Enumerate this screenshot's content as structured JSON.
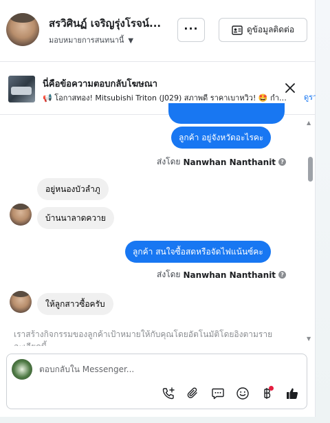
{
  "header": {
    "contact_name": "สรวิศินฏ์ เจริญรุ่งโรจน์...",
    "assign_label": "มอบหมายการสนทนานี้",
    "more_label": "···",
    "contact_info_label": "ดูข้อมูลติดต่อ"
  },
  "ad": {
    "title": "นี่คือข้อความตอบกลับโฆษณา",
    "description": "📢 โอกาสทอง! Mitsubishi Triton (J029) สภาพดี ราคาเบาหวิว! 🤩 กำลั...",
    "link_label": "ดูรา"
  },
  "messages": {
    "out1": "ลูกค้า   อยู่จังหวัดอะไรคะ",
    "sent_prefix": "ส่งโดย",
    "sender": "Nanwhan Nanthanit",
    "in1": "อยู่หนองบัวลำภู",
    "in2": "บ้านนาลาดควาย",
    "out2": "ลูกค้า  สนใจซื้อสดหรือจัดไฟแน้นซ์คะ",
    "in3": "ให้ลูกสาวซื้อครับ",
    "notice": "เราสร้างกิจกรรมของลูกค้าเป้าหมายให้กับคุณโดยอัตโนมัติโดยอิงตามรายละเอียดนี้"
  },
  "composer": {
    "placeholder": "ตอบกลับใน Messenger..."
  },
  "colors": {
    "brand_blue": "#1877f2",
    "incoming_bubble": "#f0f0f0",
    "notification_red": "#e41e3f"
  }
}
